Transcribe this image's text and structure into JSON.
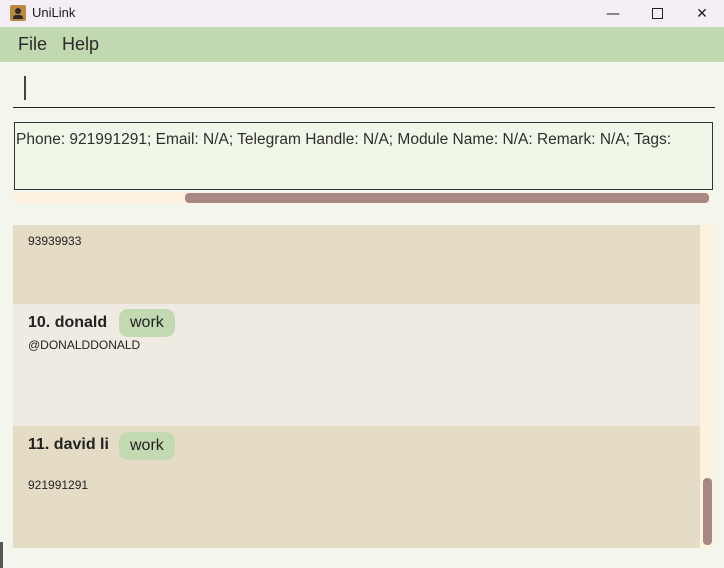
{
  "window": {
    "title": "UniLink",
    "controls": {
      "minimize": "—",
      "close": "✕"
    }
  },
  "menu": {
    "items": [
      "File",
      "Help"
    ]
  },
  "command_box": {
    "value": ""
  },
  "result_display": {
    "text": "Phone: 921991291; Email: N/A; Telegram Handle: N/A; Module Name: N/A: Remark: N/A; Tags:"
  },
  "contacts": [
    {
      "detail": "93939933"
    },
    {
      "name": "10. donald",
      "tag": "work",
      "detail": "@DONALDDONALD"
    },
    {
      "name": "11. david li",
      "tag": "work",
      "detail": "921991291"
    }
  ]
}
